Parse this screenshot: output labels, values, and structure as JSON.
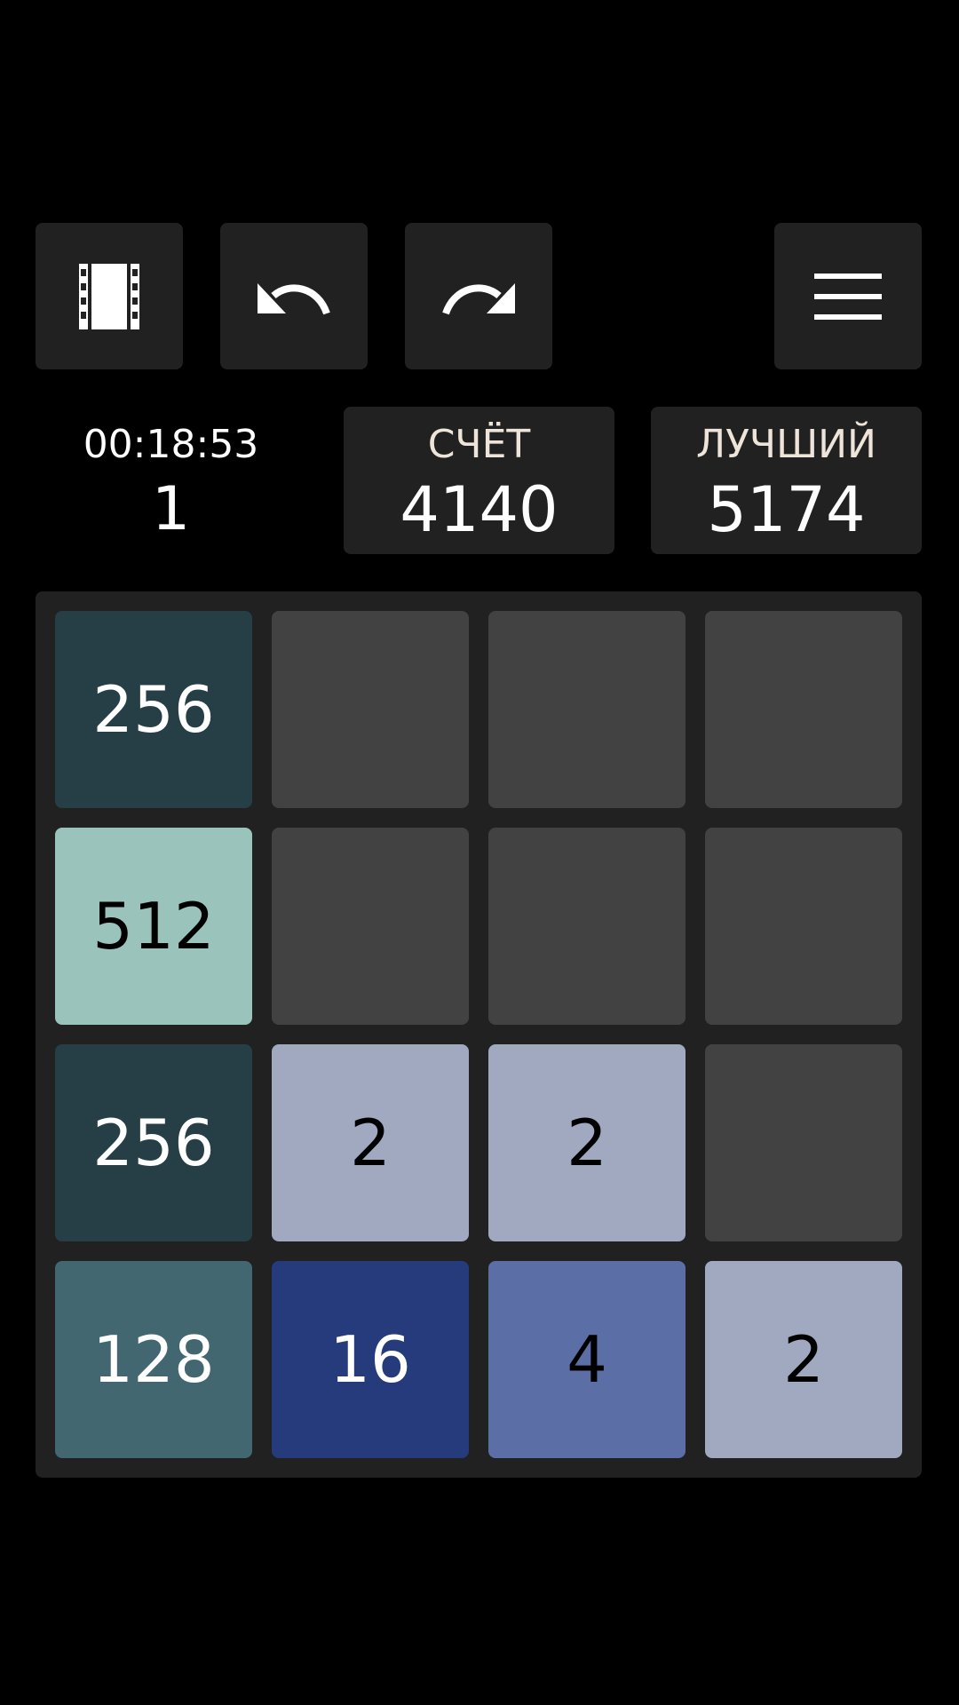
{
  "toolbar": {
    "buttons": [
      {
        "name": "replay-button",
        "icon": "film-icon"
      },
      {
        "name": "undo-button",
        "icon": "undo-icon"
      },
      {
        "name": "redo-button",
        "icon": "redo-icon"
      },
      {
        "name": "menu-button",
        "icon": "menu-icon"
      }
    ]
  },
  "stats": {
    "timer": "00:18:53",
    "moves": "1",
    "score_label": "СЧЁТ",
    "score": "4140",
    "best_label": "ЛУЧШИЙ",
    "best": "5174"
  },
  "board": {
    "rows": [
      [
        "256",
        "",
        "",
        ""
      ],
      [
        "512",
        "",
        "",
        ""
      ],
      [
        "256",
        "2",
        "2",
        ""
      ],
      [
        "128",
        "16",
        "4",
        "2"
      ]
    ]
  },
  "colors": {
    "background": "#000000",
    "panel": "#212121",
    "empty_cell": "#424242",
    "label_text": "#eee4da",
    "tile_2": "#a0a9c0",
    "tile_4": "#5c6ea6",
    "tile_16": "#263b7c",
    "tile_128": "#426771",
    "tile_256": "#263f47",
    "tile_512": "#9ac3bb"
  }
}
